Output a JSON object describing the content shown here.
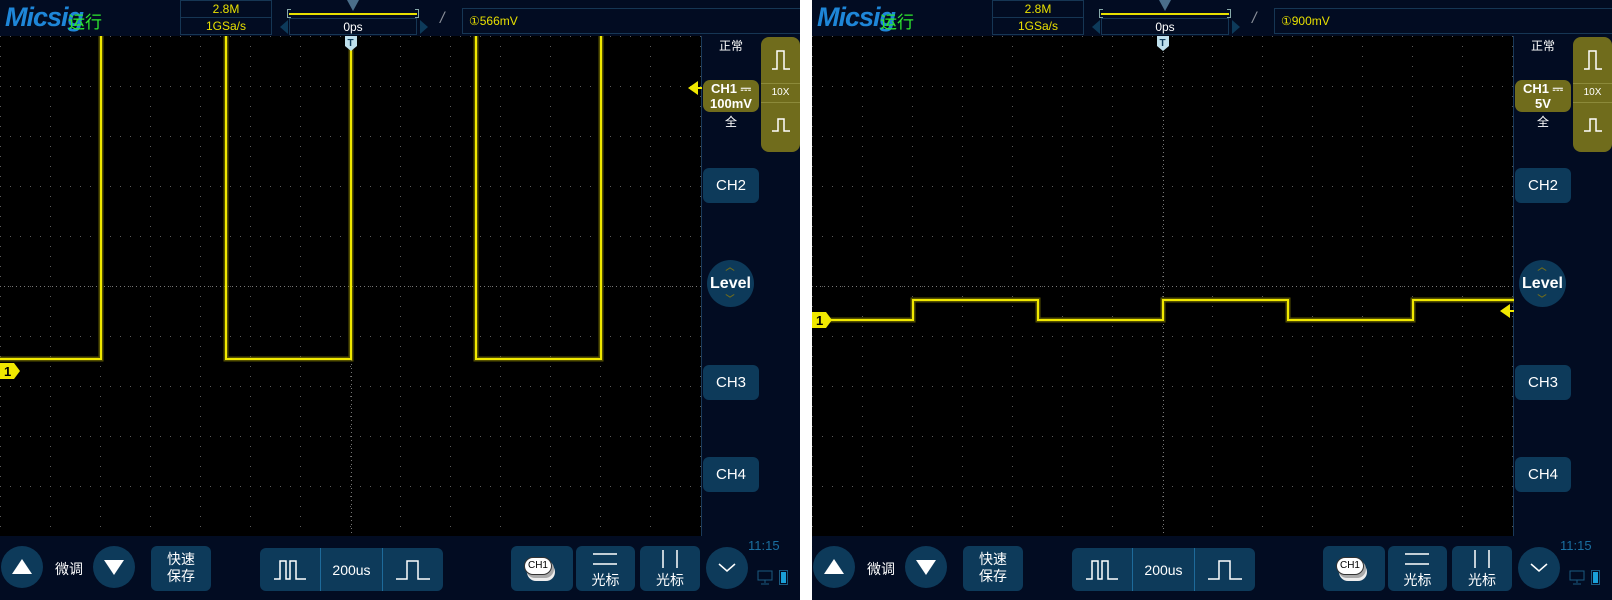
{
  "colors": {
    "background": "#020c22",
    "button": "#0d3a5a",
    "channel1": "#f0e800",
    "olive": "#706c1c",
    "logo": "#1e86d8",
    "run_status": "#2ee82e",
    "clock": "#1a6fa0"
  },
  "panels": [
    {
      "header": {
        "logo": "Micsig",
        "run_status": "运行",
        "memory_depth": "2.8M",
        "sample_rate": "1GSa/s",
        "horizontal_position": "0ps",
        "trigger_edge_icon": "rising-edge-icon",
        "trigger_level": "①566mV"
      },
      "side": {
        "trigger_mode": "正常",
        "channel_label": "CH1 ⎓",
        "channel_scale": "100mV",
        "bandwidth": "全",
        "probe": "10X",
        "ch2": "CH2",
        "level": "Level",
        "ch3": "CH3",
        "ch4": "CH4",
        "clock": "11:15"
      },
      "bottom": {
        "fine_label": "微调",
        "quick_save": [
          "快速",
          "保存"
        ],
        "timebase": "200us",
        "ch1_button": "CH1",
        "cursor_h": "光标",
        "cursor_v": "光标"
      },
      "channel_marker": "1",
      "waveform": {
        "timebase_us_per_div": 200,
        "volts_per_div": 0.1,
        "offset_v": -0.17,
        "low_v": 0.024,
        "high_v": 2.0,
        "edges_us": [
          -1000,
          -500,
          0,
          500,
          1000
        ],
        "initial_state": "low",
        "trigger_v": 0.566
      }
    },
    {
      "header": {
        "logo": "Micsig",
        "run_status": "运行",
        "memory_depth": "2.8M",
        "sample_rate": "1GSa/s",
        "horizontal_position": "0ps",
        "trigger_edge_icon": "rising-edge-icon",
        "trigger_level": "①900mV"
      },
      "side": {
        "trigger_mode": "正常",
        "channel_label": "CH1 ⎓",
        "channel_scale": "5V",
        "bandwidth": "全",
        "probe": "10X",
        "ch2": "CH2",
        "level": "Level",
        "ch3": "CH3",
        "ch4": "CH4",
        "clock": "11:15"
      },
      "bottom": {
        "fine_label": "微调",
        "quick_save": [
          "快速",
          "保存"
        ],
        "timebase": "200us",
        "ch1_button": "CH1",
        "cursor_h": "光标",
        "cursor_v": "光标"
      },
      "channel_marker": "1",
      "waveform": {
        "timebase_us_per_div": 200,
        "volts_per_div": 5,
        "offset_v": -3.4,
        "low_v": 0,
        "high_v": 2.0,
        "edges_us": [
          -1000,
          -500,
          0,
          500,
          1000
        ],
        "initial_state": "low",
        "trigger_v": 0.9
      }
    }
  ]
}
